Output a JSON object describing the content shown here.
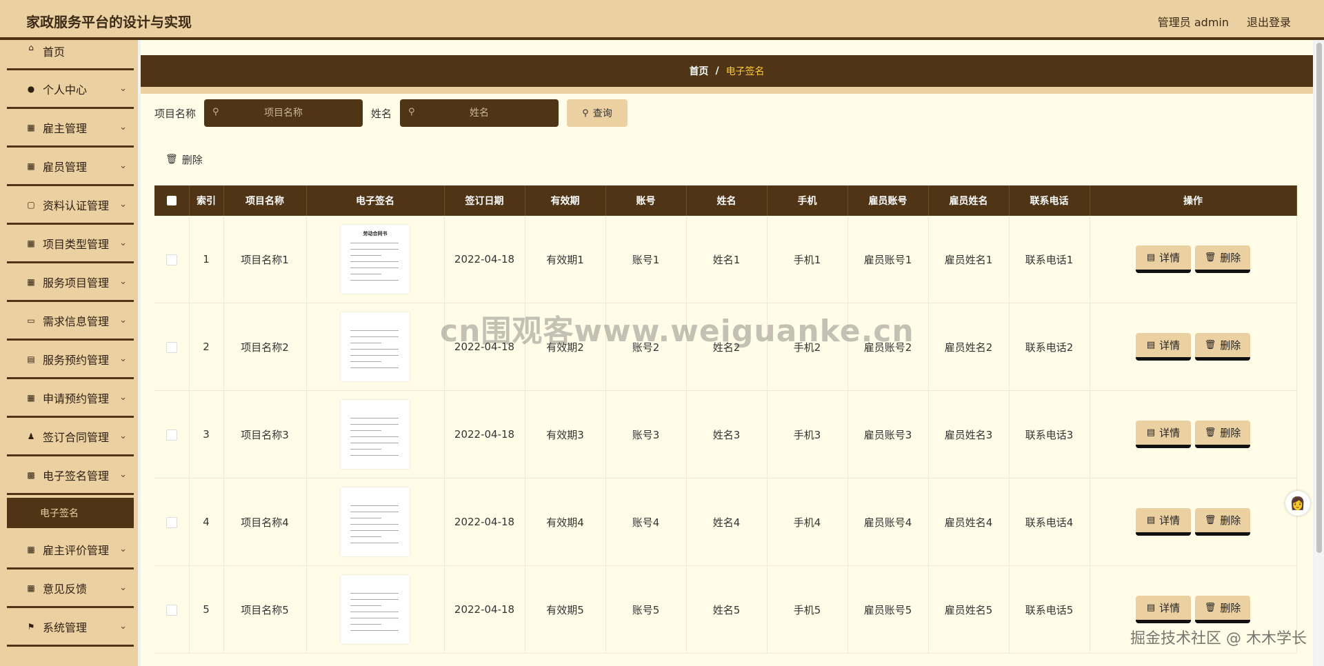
{
  "header": {
    "title": "家政服务平台的设计与实现",
    "user": "管理员 admin",
    "logout": "退出登录"
  },
  "sidebar": {
    "items": [
      {
        "label": "首页",
        "icon": "home-icon"
      },
      {
        "label": "个人中心",
        "icon": "user-icon"
      },
      {
        "label": "雇主管理",
        "icon": "grid-icon"
      },
      {
        "label": "雇员管理",
        "icon": "grid-icon"
      },
      {
        "label": "资料认证管理",
        "icon": "badge-icon"
      },
      {
        "label": "项目类型管理",
        "icon": "grid-icon"
      },
      {
        "label": "服务项目管理",
        "icon": "grid-icon"
      },
      {
        "label": "需求信息管理",
        "icon": "monitor-icon"
      },
      {
        "label": "服务预约管理",
        "icon": "clipboard-icon"
      },
      {
        "label": "申请预约管理",
        "icon": "grid-icon"
      },
      {
        "label": "签订合同管理",
        "icon": "person-icon"
      },
      {
        "label": "电子签名管理",
        "icon": "chat-icon"
      },
      {
        "label": "雇主评价管理",
        "icon": "grid-icon"
      },
      {
        "label": "意见反馈",
        "icon": "grid-icon"
      },
      {
        "label": "系统管理",
        "icon": "flag-icon"
      }
    ],
    "active_sub": "电子签名"
  },
  "breadcrumb": {
    "home": "首页",
    "separator": "/",
    "current": "电子签名"
  },
  "search": {
    "project_label": "项目名称",
    "project_placeholder": "项目名称",
    "name_label": "姓名",
    "name_placeholder": "姓名",
    "query_button": "查询"
  },
  "toolbar": {
    "delete_label": "删除"
  },
  "table": {
    "columns": [
      "索引",
      "项目名称",
      "电子签名",
      "签订日期",
      "有效期",
      "账号",
      "姓名",
      "手机",
      "雇员账号",
      "雇员姓名",
      "联系电话",
      "操作"
    ],
    "rows": [
      {
        "index": "1",
        "project": "项目名称1",
        "sig_title": "劳动合同书",
        "date": "2022-04-18",
        "validity": "有效期1",
        "account": "账号1",
        "name": "姓名1",
        "phone": "手机1",
        "emp_account": "雇员账号1",
        "emp_name": "雇员姓名1",
        "contact": "联系电话1"
      },
      {
        "index": "2",
        "project": "项目名称2",
        "sig_title": "",
        "date": "2022-04-18",
        "validity": "有效期2",
        "account": "账号2",
        "name": "姓名2",
        "phone": "手机2",
        "emp_account": "雇员账号2",
        "emp_name": "雇员姓名2",
        "contact": "联系电话2"
      },
      {
        "index": "3",
        "project": "项目名称3",
        "sig_title": "",
        "date": "2022-04-18",
        "validity": "有效期3",
        "account": "账号3",
        "name": "姓名3",
        "phone": "手机3",
        "emp_account": "雇员账号3",
        "emp_name": "雇员姓名3",
        "contact": "联系电话3"
      },
      {
        "index": "4",
        "project": "项目名称4",
        "sig_title": "",
        "date": "2022-04-18",
        "validity": "有效期4",
        "account": "账号4",
        "name": "姓名4",
        "phone": "手机4",
        "emp_account": "雇员账号4",
        "emp_name": "雇员姓名4",
        "contact": "联系电话4"
      },
      {
        "index": "5",
        "project": "项目名称5",
        "sig_title": "",
        "date": "2022-04-18",
        "validity": "有效期5",
        "account": "账号5",
        "name": "姓名5",
        "phone": "手机5",
        "emp_account": "雇员账号5",
        "emp_name": "雇员姓名5",
        "contact": "联系电话5"
      }
    ],
    "detail_label": "详情",
    "delete_label": "删除"
  },
  "watermarks": {
    "center": "cn围观客www.weiguanke.cn",
    "corner": "掘金技术社区 @ 木木学长"
  },
  "colors": {
    "brand_dark": "#4f3416",
    "brand_light": "#ebd0a2",
    "content_bg": "#fffde8",
    "breadcrumb_current": "#ffcc33"
  }
}
